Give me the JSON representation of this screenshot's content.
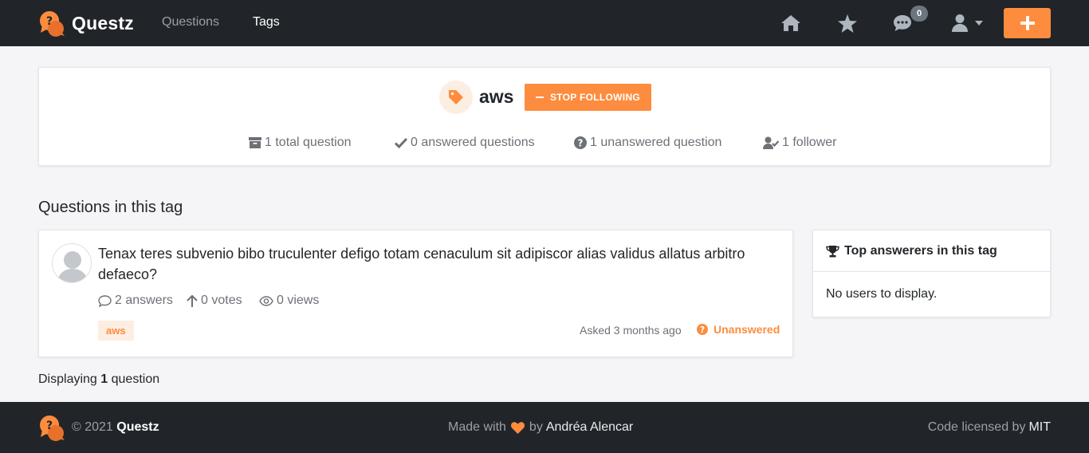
{
  "navbar": {
    "brand": "Questz",
    "links": [
      "Questions",
      "Tags"
    ],
    "active_link": "Tags",
    "messages_badge": "0"
  },
  "tag": {
    "name": "aws",
    "follow_button": "STOP FOLLOWING",
    "stats": {
      "total": "1 total question",
      "answered": "0 answered questions",
      "unanswered": "1 unanswered question",
      "followers": "1 follower"
    }
  },
  "section": {
    "title": "Questions in this tag"
  },
  "question": {
    "title": "Tenax teres subvenio bibo truculenter defigo totam cenaculum sit adipiscor alias validus allatus arbitro defaeco?",
    "answers": "2 answers",
    "votes": "0 votes",
    "views": "0 views",
    "tag": "aws",
    "asked": "Asked 3 months ago",
    "status": "Unanswered"
  },
  "pagination": {
    "prefix": "Displaying",
    "count": "1",
    "suffix": "question"
  },
  "sidebar": {
    "title": "Top answerers in this tag",
    "empty": "No users to display."
  },
  "footer": {
    "copyright": "© 2021",
    "brand": "Questz",
    "made_with": "Made with",
    "by": "by",
    "author": "Andréa Alencar",
    "license_text": "Code licensed by",
    "license": "MIT"
  },
  "colors": {
    "accent": "#fd8c3e",
    "navbar": "#212529",
    "background": "#f5f5f7"
  }
}
